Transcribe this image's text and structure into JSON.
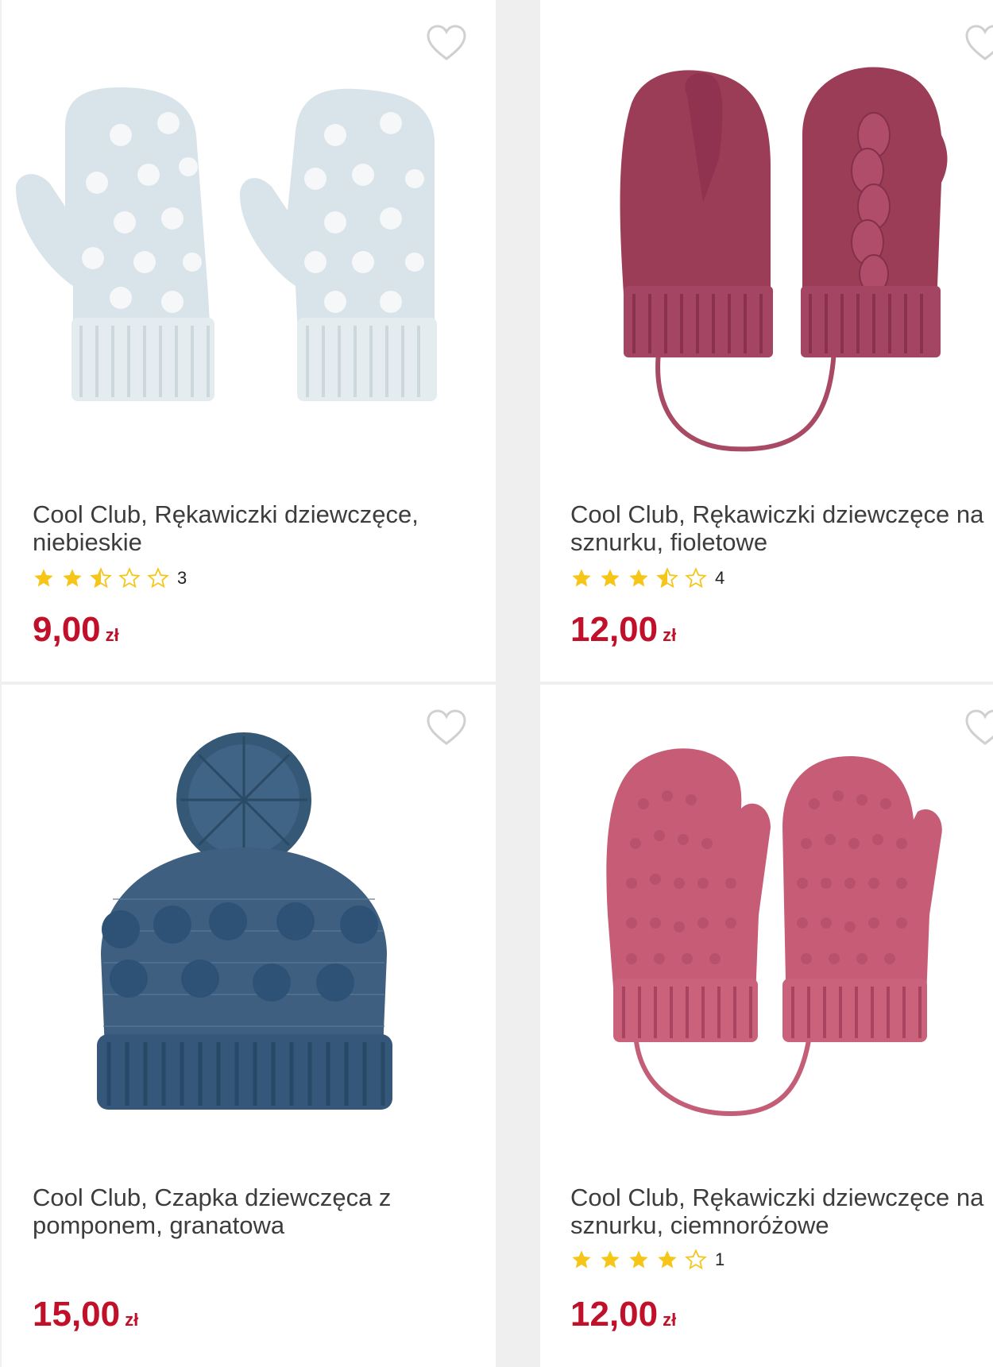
{
  "products": [
    {
      "title": "Cool Club, Rękawiczki dziewczęce, niebieskie",
      "rating": 2.5,
      "rating_count": "3",
      "price": "9,00",
      "currency": "zł",
      "image_icon": "light-blue-mittens-with-hearts",
      "favorite_icon": "heart-outline-icon"
    },
    {
      "title": "Cool Club, Rękawiczki dziewczęce na sznurku, fioletowe",
      "rating": 3.5,
      "rating_count": "4",
      "price": "12,00",
      "currency": "zł",
      "image_icon": "plum-mittens-on-string",
      "favorite_icon": "heart-outline-icon"
    },
    {
      "title": "Cool Club, Czapka dziewczęca z pomponem, granatowa",
      "rating": null,
      "rating_count": "",
      "price": "15,00",
      "currency": "zł",
      "image_icon": "navy-pompom-hat",
      "favorite_icon": "heart-outline-icon"
    },
    {
      "title": "Cool Club, Rękawiczki dziewczęce na sznurku, ciemnoróżowe",
      "rating": 4,
      "rating_count": "1",
      "price": "12,00",
      "currency": "zł",
      "image_icon": "dark-pink-mittens-on-string",
      "favorite_icon": "heart-outline-icon"
    }
  ],
  "colors": {
    "price": "#c0102a",
    "star": "#f5c518",
    "title": "#3d3d3d",
    "heart": "#d0d0d0"
  }
}
